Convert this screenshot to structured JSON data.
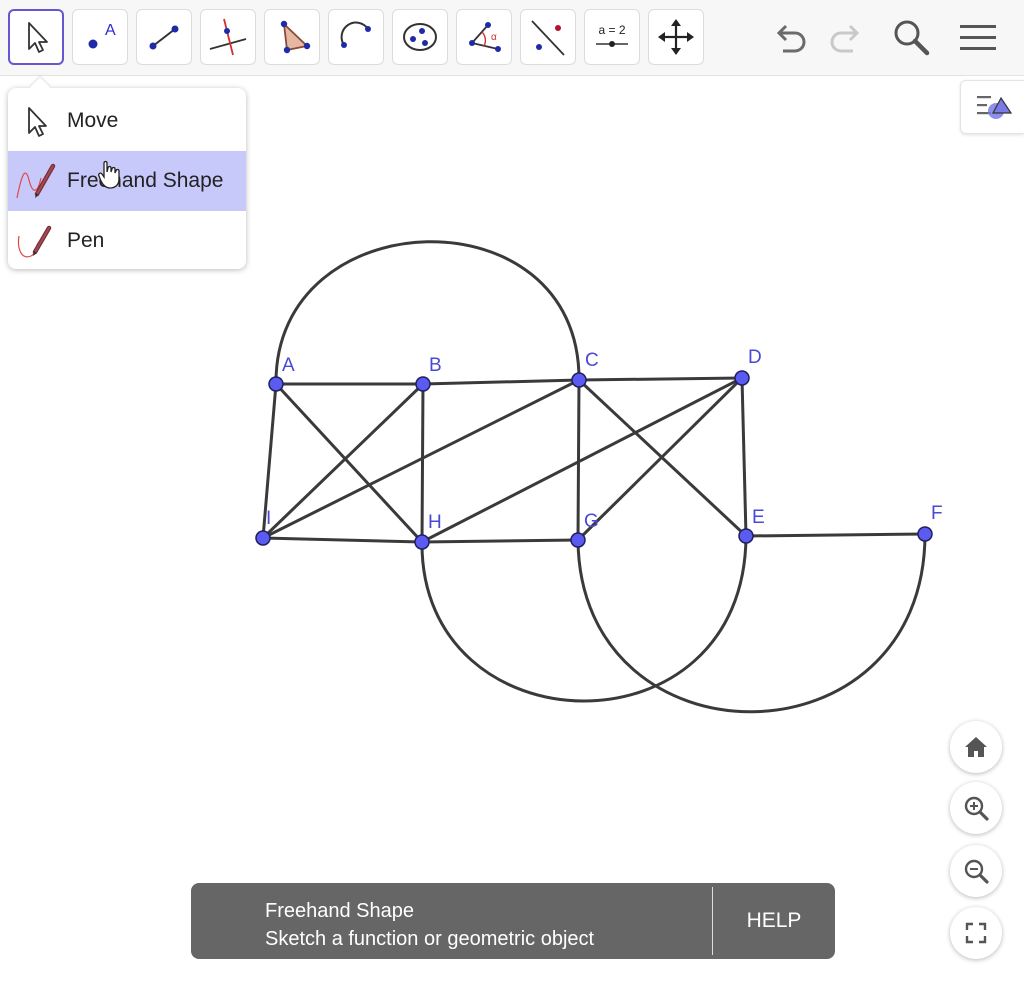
{
  "toolbar": {
    "tools": [
      {
        "icon": "move-arrow-icon"
      },
      {
        "icon": "point-icon",
        "letter": "A"
      },
      {
        "icon": "segment-icon"
      },
      {
        "icon": "perpendicular-line-icon"
      },
      {
        "icon": "polygon-icon"
      },
      {
        "icon": "circular-arc-icon"
      },
      {
        "icon": "ellipse-icon"
      },
      {
        "icon": "angle-icon",
        "letter": "α"
      },
      {
        "icon": "reflect-about-line-icon"
      },
      {
        "icon": "slider-icon",
        "label": "a = 2"
      },
      {
        "icon": "move-graphics-view-icon"
      }
    ],
    "right_icons": [
      "undo-icon",
      "redo-icon",
      "search-icon",
      "menu-icon"
    ]
  },
  "menu": {
    "items": [
      {
        "label": "Move",
        "icon": "move-arrow-icon"
      },
      {
        "label": "Freehand Shape",
        "icon": "freehand-shape-icon",
        "active": true
      },
      {
        "label": "Pen",
        "icon": "pen-icon"
      }
    ]
  },
  "points": [
    {
      "label": "A"
    },
    {
      "label": "B"
    },
    {
      "label": "C"
    },
    {
      "label": "D"
    },
    {
      "label": "E"
    },
    {
      "label": "F"
    },
    {
      "label": "G"
    },
    {
      "label": "H"
    },
    {
      "label": "I"
    }
  ],
  "colors": {
    "point_fill": "#5b5bf2",
    "point_stroke": "#1f1f5e",
    "label": "#4a48d6",
    "line": "#3a3a3a",
    "selected_tool_border": "#6557d2",
    "menu_active_bg": "#c8c9fb",
    "help_bg": "#666666"
  },
  "zoom_controls": [
    "home-icon",
    "zoom-in-icon",
    "zoom-out-icon",
    "fullscreen-icon"
  ],
  "help": {
    "title": "Freehand Shape",
    "description": "Sketch a function or geometric object",
    "button": "HELP"
  }
}
